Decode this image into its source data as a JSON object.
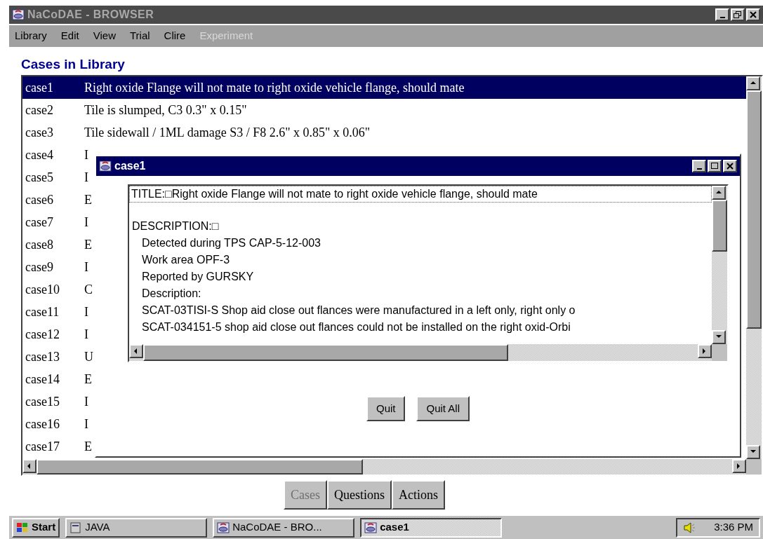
{
  "window": {
    "title": "NaCoDAE - BROWSER"
  },
  "menu": [
    {
      "label": "Library",
      "disabled": false
    },
    {
      "label": "Edit",
      "disabled": false
    },
    {
      "label": "View",
      "disabled": false
    },
    {
      "label": "Trial",
      "disabled": false
    },
    {
      "label": "Clire",
      "disabled": false
    },
    {
      "label": "Experiment",
      "disabled": true
    }
  ],
  "heading": "Cases in Library",
  "cases": [
    {
      "id": "case1",
      "text": "Right oxide Flange will not mate to right oxide vehicle flange, should mate",
      "selected": true
    },
    {
      "id": "case2",
      "text": "Tile is slumped, C3   0.3\" x 0.15\"",
      "selected": false
    },
    {
      "id": "case3",
      "text": "Tile sidewall / 1ML damage S3 / F8   2.6\" x 0.85\" x 0.06\"",
      "selected": false
    },
    {
      "id": "case4",
      "text": "I",
      "selected": false
    },
    {
      "id": "case5",
      "text": "I",
      "selected": false
    },
    {
      "id": "case6",
      "text": "E",
      "selected": false
    },
    {
      "id": "case7",
      "text": "I",
      "selected": false
    },
    {
      "id": "case8",
      "text": "E",
      "selected": false
    },
    {
      "id": "case9",
      "text": "I",
      "selected": false
    },
    {
      "id": "case10",
      "text": "C",
      "selected": false
    },
    {
      "id": "case11",
      "text": "I",
      "selected": false
    },
    {
      "id": "case12",
      "text": "I",
      "selected": false
    },
    {
      "id": "case13",
      "text": "U",
      "selected": false
    },
    {
      "id": "case14",
      "text": "E",
      "selected": false
    },
    {
      "id": "case15",
      "text": "I",
      "selected": false
    },
    {
      "id": "case16",
      "text": "I",
      "selected": false
    },
    {
      "id": "case17",
      "text": "E",
      "selected": false
    }
  ],
  "tabs": [
    {
      "label": "Cases",
      "disabled": true
    },
    {
      "label": "Questions",
      "disabled": false
    },
    {
      "label": "Actions",
      "disabled": false
    }
  ],
  "dialog": {
    "title": "case1",
    "title_line": "TITLE:□Right oxide Flange will not mate to right oxide vehicle flange, should mate",
    "lines": [
      {
        "text": "DESCRIPTION:□",
        "kind": "label"
      },
      {
        "text": "Detected during TPS CAP-5-12-003",
        "kind": "detail"
      },
      {
        "text": "Work area OPF-3",
        "kind": "detail"
      },
      {
        "text": "Reported by GURSKY",
        "kind": "detail"
      },
      {
        "text": "Description:",
        "kind": "detail"
      },
      {
        "text": "SCAT-03TISI-S Shop aid close out flances were manufactured in a left only, right only o",
        "kind": "detail"
      },
      {
        "text": "SCAT-034151-5 shop aid close out flances could not be installed on the right oxid-Orbi",
        "kind": "detail"
      }
    ],
    "buttons": [
      "Quit",
      "Quit All"
    ]
  },
  "taskbar": {
    "start": "Start",
    "tasks": [
      {
        "label": "JAVA",
        "active": false,
        "kind": "folder"
      },
      {
        "label": "NaCoDAE - BRO...",
        "active": false,
        "kind": "app"
      },
      {
        "label": "case1",
        "active": true,
        "kind": "app"
      }
    ],
    "clock": "3:36 PM"
  }
}
